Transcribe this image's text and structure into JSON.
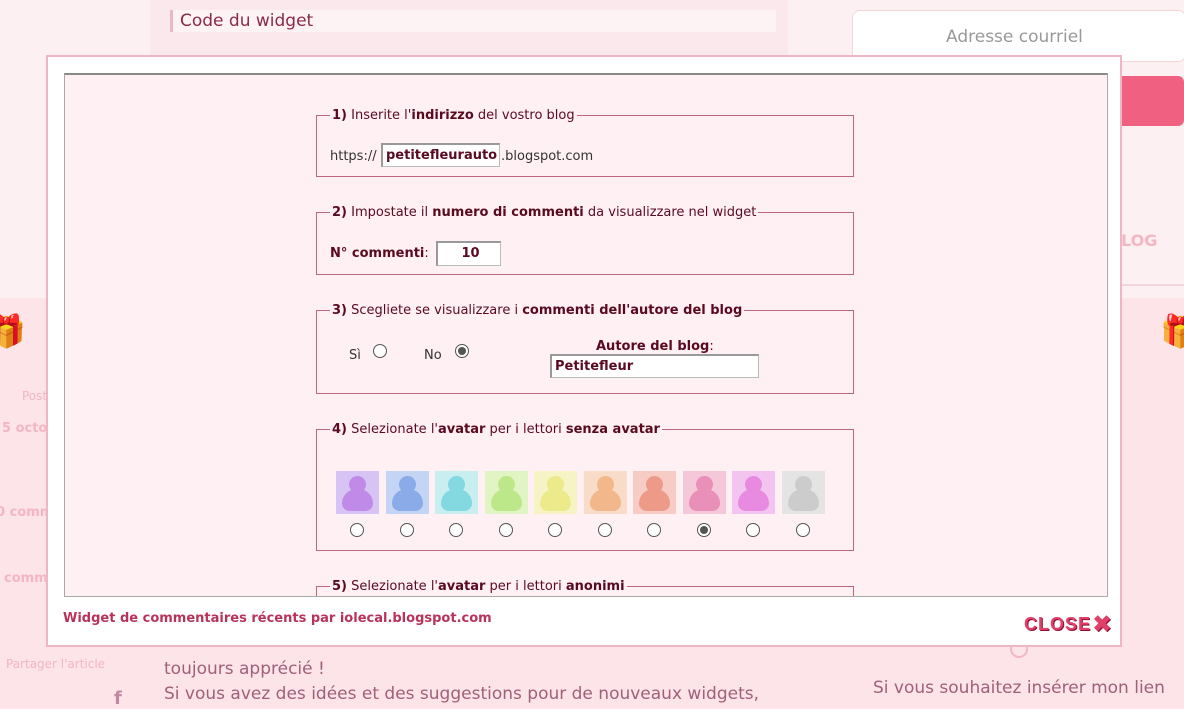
{
  "background": {
    "widget_code_label": "Code du widget",
    "email_placeholder": "Adresse courriel",
    "blog_partial": "LOG",
    "left_fragments": [
      "Post",
      "5 octo",
      "0 comm",
      "comm",
      "Partager l'article"
    ],
    "body_line1": "toujours apprécié !",
    "body_line2": "Si vous avez des idées et des suggestions pour de nouveaux widgets,",
    "right_line": "Si vous souhaitez insérer mon lien"
  },
  "modal": {
    "footer_link": "Widget de commentaires récents par iolecal.blogspot.com",
    "close_label": "CLOSE",
    "close_icon": "close-x-icon"
  },
  "section1": {
    "legend_num": "1)",
    "legend_pre": " Inserite l'",
    "legend_bold": "indirizzo",
    "legend_post": " del vostro blog",
    "prefix": "https://",
    "value": "petitefleurauto",
    "suffix": ".blogspot.com"
  },
  "section2": {
    "legend_num": "2)",
    "legend_pre": " Impostate il ",
    "legend_bold": "numero di commenti",
    "legend_post": " da visualizzare nel widget",
    "label": "N° commenti",
    "colon": ":",
    "value": "10"
  },
  "section3": {
    "legend_num": "3)",
    "legend_pre": " Scegliete se visualizzare i ",
    "legend_bold": "commenti dell'autore del blog",
    "yes_label": "Sì",
    "no_label": "No",
    "selected": "No",
    "author_label": "Autore del blog",
    "author_colon": ":",
    "author_value": "Petitefleur"
  },
  "section4": {
    "legend_num": "4)",
    "legend_pre": " Selezionate l'",
    "legend_bold": "avatar",
    "legend_mid": " per i lettori ",
    "legend_bold2": "senza avatar",
    "selected_index": 7,
    "avatar_colors": [
      {
        "bg": "#d8c4f4",
        "fig": "#c08ae8"
      },
      {
        "bg": "#c4d4f4",
        "fig": "#8aaae8"
      },
      {
        "bg": "#c8eef0",
        "fig": "#84d8e0"
      },
      {
        "bg": "#e0f4c4",
        "fig": "#bce88a"
      },
      {
        "bg": "#f6f4c4",
        "fig": "#ecea8a"
      },
      {
        "bg": "#f8dcc8",
        "fig": "#f2b88c"
      },
      {
        "bg": "#f6ccc4",
        "fig": "#ee9a88"
      },
      {
        "bg": "#f4c8d8",
        "fig": "#e890b8"
      },
      {
        "bg": "#f4c4f0",
        "fig": "#e88ae0"
      },
      {
        "bg": "#e4e4e4",
        "fig": "#cccccc"
      }
    ]
  },
  "section5": {
    "legend_num": "5)",
    "legend_pre": " Selezionate l'",
    "legend_bold": "avatar",
    "legend_mid": " per i lettori ",
    "legend_bold2": "anonimi"
  }
}
